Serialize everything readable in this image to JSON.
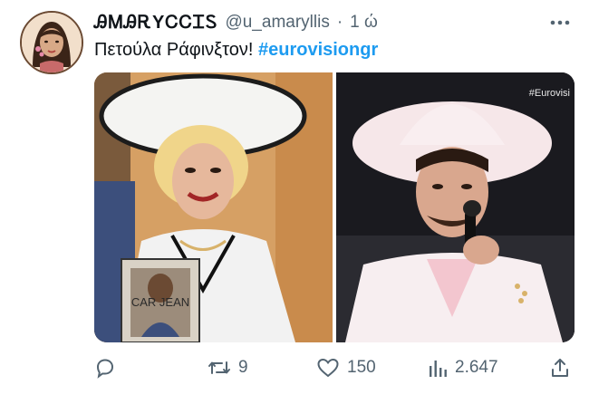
{
  "tweet": {
    "author": {
      "display_name": "ᎯᎷᎯᎡYᏟᏟᏆᏚ",
      "handle": "@u_amaryllis",
      "avatar_icon": "illustrated-face-avatar"
    },
    "separator": "·",
    "time": "1 ώ",
    "text_plain": "Πετούλα Ράφινξτον!",
    "hashtag": "#eurovisiongr",
    "more_icon": "more-horizontal-icon",
    "media": {
      "left_image_caption": "CAR JEAN",
      "right_image_watermark": "#Eurovisi"
    },
    "actions": {
      "reply": {
        "icon": "reply-icon",
        "count": ""
      },
      "retweet": {
        "icon": "retweet-icon",
        "count": "9"
      },
      "like": {
        "icon": "heart-icon",
        "count": "150"
      },
      "views": {
        "icon": "views-icon",
        "count": "2.647"
      },
      "share": {
        "icon": "share-icon",
        "count": ""
      }
    }
  },
  "colors": {
    "text_primary": "#0f1419",
    "text_secondary": "#536471",
    "hashtag": "#1d9bf0",
    "background": "#ffffff"
  }
}
